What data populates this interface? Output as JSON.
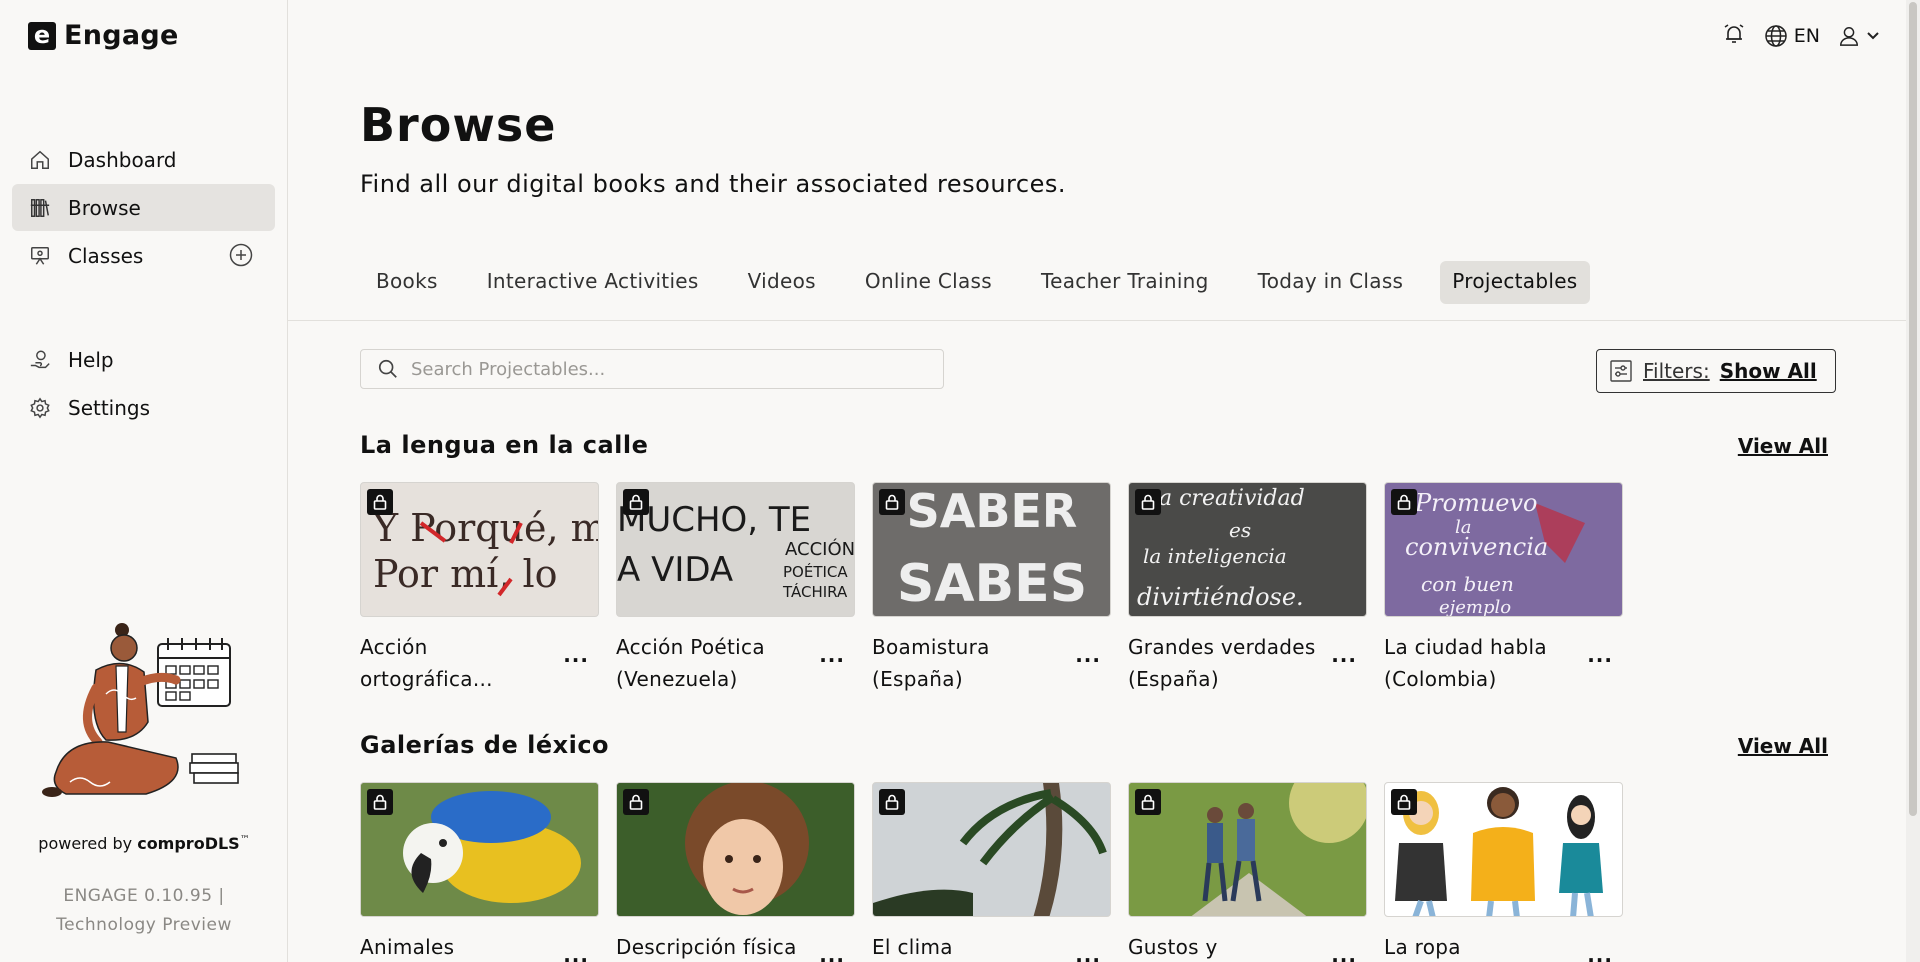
{
  "app": {
    "name": "Engage",
    "logo_letter": "e"
  },
  "sidebar": {
    "nav": [
      {
        "label": "Dashboard",
        "icon": "home-icon"
      },
      {
        "label": "Browse",
        "icon": "books-icon",
        "active": true
      },
      {
        "label": "Classes",
        "icon": "classroom-icon"
      }
    ],
    "nav2": [
      {
        "label": "Help",
        "icon": "help-hand-icon"
      },
      {
        "label": "Settings",
        "icon": "gear-icon"
      }
    ],
    "powered_prefix": "powered by ",
    "powered_brand": "comproDLS",
    "powered_tm": "™",
    "version_line1": "ENGAGE 0.10.95 |",
    "version_line2": "Technology Preview"
  },
  "topbar": {
    "language": "EN"
  },
  "main": {
    "title": "Browse",
    "subtitle": "Find all our digital books and their associated resources.",
    "tabs": [
      {
        "label": "Books"
      },
      {
        "label": "Interactive Activities"
      },
      {
        "label": "Videos"
      },
      {
        "label": "Online Class"
      },
      {
        "label": "Teacher Training"
      },
      {
        "label": "Today in Class"
      },
      {
        "label": "Projectables",
        "active": true
      }
    ],
    "search_placeholder": "Search Projectables...",
    "filters_label": "Filters:",
    "filters_value": "Show All",
    "sections": [
      {
        "title": "La lengua en la calle",
        "view_all": "View All",
        "cards": [
          {
            "title": "Acción ortográfica..."
          },
          {
            "title": "Acción Poética (Venezuela)"
          },
          {
            "title": "Boamistura (España)"
          },
          {
            "title": "Grandes verdades (España)"
          },
          {
            "title": "La ciudad habla (Colombia)"
          }
        ]
      },
      {
        "title": "Galerías de léxico",
        "view_all": "View All",
        "cards": [
          {
            "title": "Animales"
          },
          {
            "title": "Descripción física"
          },
          {
            "title": "El clima"
          },
          {
            "title": "Gustos y"
          },
          {
            "title": "La ropa"
          }
        ]
      }
    ],
    "thumb_text": {
      "t0": [
        "Y Porqué, mi",
        "Por mí, lo"
      ],
      "t1": [
        "MUCHO, TE",
        "A VIDA",
        "ACCIÓN",
        "POÉTICA",
        "TÁCHIRA"
      ],
      "t2": [
        "SABER",
        "SABES"
      ],
      "t3": [
        "a creatividad",
        "es",
        "la inteligencia",
        "divirtiéndose."
      ],
      "t4": [
        "Promuevo",
        "la",
        "convivencia",
        "con buen",
        "ejemplo"
      ]
    },
    "more_label": "..."
  }
}
